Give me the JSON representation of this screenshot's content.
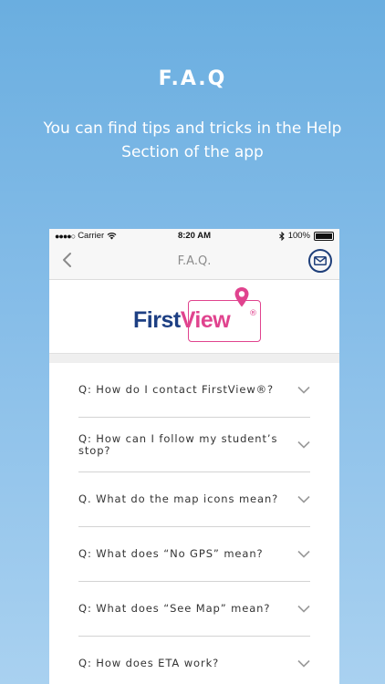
{
  "promo": {
    "title": "F.A.Q",
    "subtitle": "You can find tips and tricks in the Help Section of the app"
  },
  "status_bar": {
    "carrier": "Carrier",
    "time": "8:20 AM",
    "battery": "100%"
  },
  "nav": {
    "title": "F.A.Q.",
    "back_icon": "chevron-left-icon",
    "mail_icon": "envelope-icon"
  },
  "logo": {
    "first": "First",
    "view": "View",
    "reg": "®"
  },
  "faq": [
    {
      "question": "Q: How do I contact FirstView®?"
    },
    {
      "question": "Q: How can I follow my student’s stop?"
    },
    {
      "question": "Q. What do the map icons mean?"
    },
    {
      "question": "Q: What does “No GPS” mean?"
    },
    {
      "question": "Q: What does “See Map” mean?"
    },
    {
      "question": "Q: How does ETA work?"
    }
  ],
  "colors": {
    "brand_blue": "#1d3f83",
    "brand_pink": "#e0438e"
  }
}
